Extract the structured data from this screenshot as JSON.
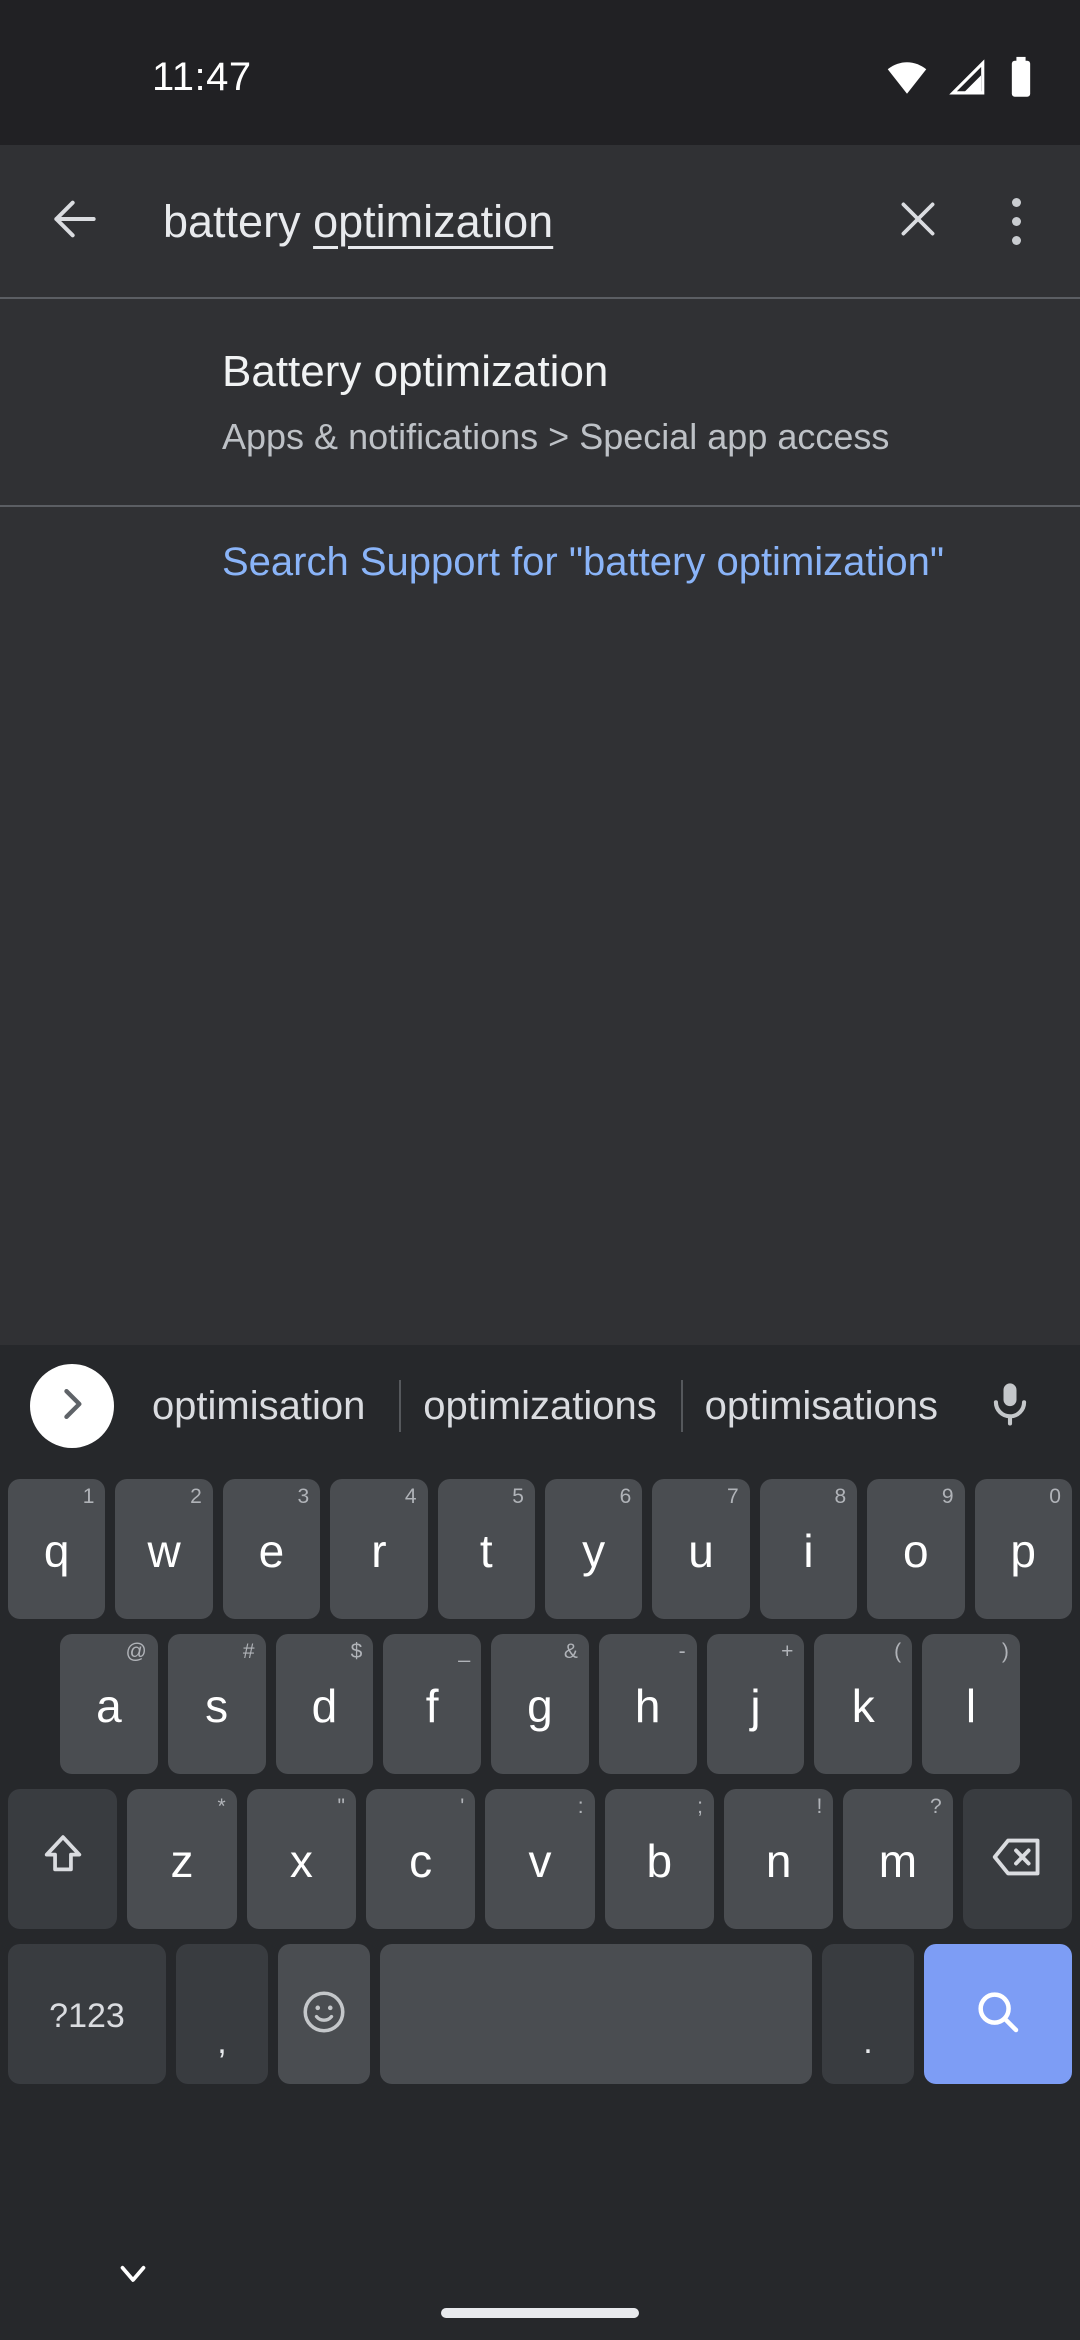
{
  "status_bar": {
    "time": "11:47",
    "icons": [
      "wifi-icon",
      "cellular-signal-icon",
      "battery-icon"
    ]
  },
  "toolbar": {
    "back_icon": "arrow-back-icon",
    "query_prefix": "battery ",
    "query_composing": "optimization",
    "query_full": "battery optimization",
    "clear_icon": "close-icon",
    "overflow_icon": "more-vert-icon"
  },
  "results": {
    "items": [
      {
        "title": "Battery optimization",
        "breadcrumb": "Apps & notifications > Special app access"
      }
    ],
    "support_link": "Search Support for \"battery optimization\""
  },
  "keyboard": {
    "suggestions": [
      "optimisation",
      "optimizations",
      "optimisations"
    ],
    "expand_icon": "chevron-right-icon",
    "mic_icon": "microphone-icon",
    "row1": [
      {
        "key": "q",
        "hint": "1"
      },
      {
        "key": "w",
        "hint": "2"
      },
      {
        "key": "e",
        "hint": "3"
      },
      {
        "key": "r",
        "hint": "4"
      },
      {
        "key": "t",
        "hint": "5"
      },
      {
        "key": "y",
        "hint": "6"
      },
      {
        "key": "u",
        "hint": "7"
      },
      {
        "key": "i",
        "hint": "8"
      },
      {
        "key": "o",
        "hint": "9"
      },
      {
        "key": "p",
        "hint": "0"
      }
    ],
    "row2": [
      {
        "key": "a",
        "hint": "@"
      },
      {
        "key": "s",
        "hint": "#"
      },
      {
        "key": "d",
        "hint": "$"
      },
      {
        "key": "f",
        "hint": "_"
      },
      {
        "key": "g",
        "hint": "&"
      },
      {
        "key": "h",
        "hint": "-"
      },
      {
        "key": "j",
        "hint": "+"
      },
      {
        "key": "k",
        "hint": "("
      },
      {
        "key": "l",
        "hint": ")"
      }
    ],
    "row3": [
      {
        "key": "z",
        "hint": "*"
      },
      {
        "key": "x",
        "hint": "\""
      },
      {
        "key": "c",
        "hint": "'"
      },
      {
        "key": "v",
        "hint": ":"
      },
      {
        "key": "b",
        "hint": ";"
      },
      {
        "key": "n",
        "hint": "!"
      },
      {
        "key": "m",
        "hint": "?"
      }
    ],
    "shift_icon": "shift-icon",
    "backspace_icon": "backspace-icon",
    "symbols_label": "?123",
    "comma_label": ",",
    "emoji_icon": "emoji-smiley-icon",
    "space_label": "",
    "period_label": ".",
    "enter_icon": "search-icon",
    "enter_color": "#7d9df5"
  },
  "navbar": {
    "hide_keyboard_icon": "chevron-down-icon",
    "home_indicator": "home-pill"
  },
  "colors": {
    "status_bg": "#212124",
    "page_bg": "#303134",
    "keyboard_bg": "#26282b",
    "key_bg": "#4a4d51",
    "key_fn_bg": "#393c40",
    "accent_link": "#8ab4f8",
    "enter_key": "#7d9df5",
    "divider": "#5b5e63"
  }
}
